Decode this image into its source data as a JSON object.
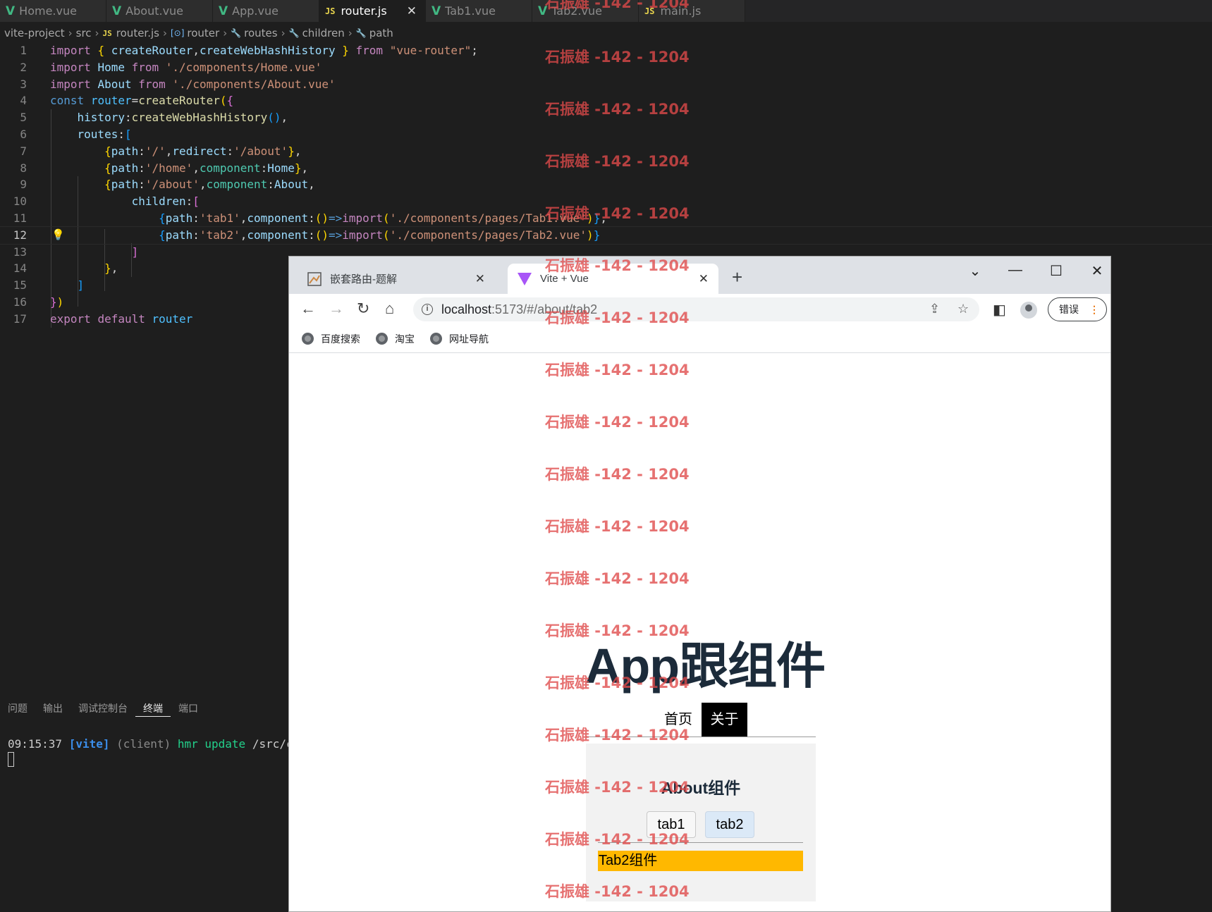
{
  "editor_tabs": [
    {
      "label": "Home.vue",
      "kind": "vue"
    },
    {
      "label": "About.vue",
      "kind": "vue"
    },
    {
      "label": "App.vue",
      "kind": "vue"
    },
    {
      "label": "router.js",
      "kind": "js",
      "active": true
    },
    {
      "label": "Tab1.vue",
      "kind": "vue"
    },
    {
      "label": "Tab2.vue",
      "kind": "vue"
    },
    {
      "label": "main.js",
      "kind": "js"
    }
  ],
  "breadcrumb": {
    "project": "vite-project",
    "folder": "src",
    "file": "router.js",
    "symbol1": "router",
    "symbol2": "routes",
    "symbol3": "children",
    "symbol4": "path"
  },
  "code": {
    "line_numbers": [
      "1",
      "2",
      "3",
      "4",
      "5",
      "6",
      "7",
      "8",
      "9",
      "10",
      "11",
      "12",
      "13",
      "14",
      "15",
      "16",
      "17"
    ],
    "current_line": "12"
  },
  "panel": {
    "tabs": [
      "问题",
      "输出",
      "调试控制台",
      "终端",
      "端口"
    ],
    "active_tab": "终端",
    "terminal_time": "09:15:37",
    "terminal_vite": "[vite]",
    "terminal_client": "(client)",
    "terminal_hmr": "hmr update",
    "terminal_path": "/src/com"
  },
  "browser": {
    "tab_inactive_title": "嵌套路由-题解",
    "tab_active_title": "Vite + Vue",
    "url_host": "localhost",
    "url_rest": ":5173/#/about/tab2",
    "error_button": "错误",
    "bookmarks": [
      "百度搜索",
      "淘宝",
      "网址导航"
    ]
  },
  "page": {
    "title": "App跟组件",
    "nav_home": "首页",
    "nav_about": "关于",
    "about_title": "About组件",
    "tab1_label": "tab1",
    "tab2_label": "tab2",
    "tab2_content": "Tab2组件"
  },
  "watermark_text": "石振雄 -142 - 1204",
  "colors": {
    "accent_vue": "#41b883",
    "active_nav_bg": "#000000",
    "tab2_content_bg": "#ffb800",
    "watermark": "#e04a4a"
  }
}
